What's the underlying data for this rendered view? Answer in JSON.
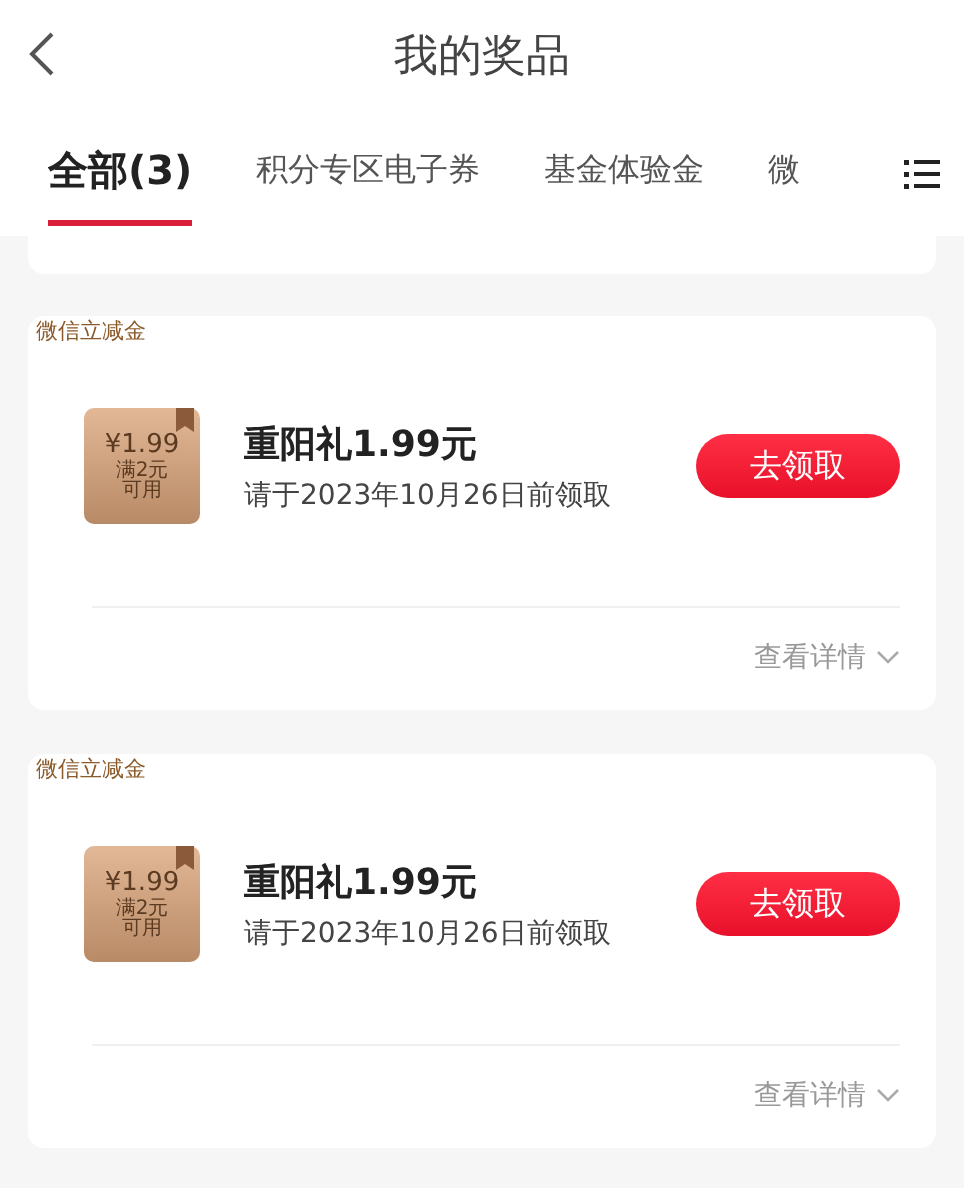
{
  "header": {
    "title": "我的奖品"
  },
  "tabs": [
    {
      "label": "全部(3)",
      "selected": true
    },
    {
      "label": "积分专区电子券",
      "selected": false
    },
    {
      "label": "基金体验金",
      "selected": false
    },
    {
      "label": "微",
      "selected": false
    }
  ],
  "prizes": [
    {
      "tag": "微信立减金",
      "ticket_amount": "¥1.99",
      "ticket_condition": "满2元",
      "ticket_usage": "可用",
      "title": "重阳礼1.99元",
      "deadline": "请于2023年10月26日前领取",
      "action": "去领取",
      "details": "查看详情"
    },
    {
      "tag": "微信立减金",
      "ticket_amount": "¥1.99",
      "ticket_condition": "满2元",
      "ticket_usage": "可用",
      "title": "重阳礼1.99元",
      "deadline": "请于2023年10月26日前领取",
      "action": "去领取",
      "details": "查看详情"
    }
  ]
}
